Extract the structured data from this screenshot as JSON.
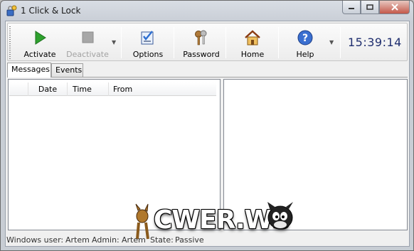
{
  "window": {
    "title": "1 Click & Lock"
  },
  "toolbar": {
    "activate_label": "Activate",
    "deactivate_label": "Deactivate",
    "options_label": "Options",
    "password_label": "Password",
    "home_label": "Home",
    "help_label": "Help",
    "clock": "15:39:14"
  },
  "tabs": [
    {
      "label": "Messages"
    },
    {
      "label": "Events"
    }
  ],
  "grid": {
    "columns": [
      "Date",
      "Time",
      "From"
    ]
  },
  "status": {
    "windows_user_label": "Windows user:",
    "windows_user_value": "Artem",
    "admin_label": "Admin:",
    "admin_value": "Artem",
    "state_label": "State:",
    "state_value": "Passive"
  },
  "watermark": {
    "text": "CWER.WS"
  },
  "colors": {
    "accent_green": "#2ea12e",
    "clock_blue": "#1e2d6e",
    "help_blue": "#3a6fd0"
  }
}
